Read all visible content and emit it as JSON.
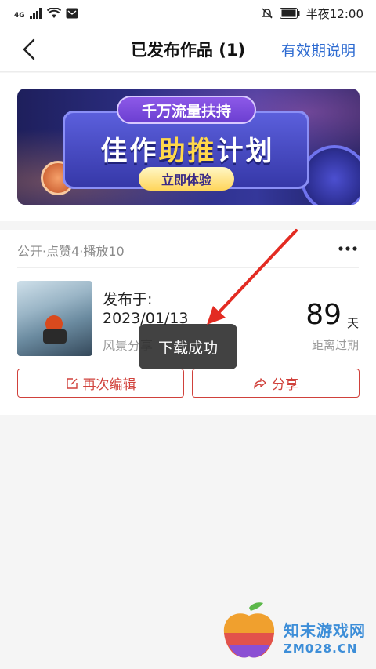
{
  "status_bar": {
    "network": "4G",
    "time": "半夜12:00"
  },
  "nav": {
    "title": "已发布作品 (1)",
    "link": "有效期说明"
  },
  "banner": {
    "top_label": "千万流量扶持",
    "title_part1": "佳作",
    "title_highlight": "助推",
    "title_part2": "计划",
    "button": "立即体验"
  },
  "work": {
    "stats": "公开·点赞4·播放10",
    "published_label": "发布于:",
    "published_date": "2023/01/13",
    "category": "风景分享",
    "days": "89",
    "days_unit": "天",
    "days_caption": "距离过期",
    "edit_label": "再次编辑",
    "share_label": "分享"
  },
  "toast": {
    "message": "下载成功"
  },
  "watermark": {
    "name": "知末游戏网",
    "url": "ZM028.CN"
  },
  "colors": {
    "accent": "#d0413b",
    "link": "#2c6ad1",
    "annotation_arrow": "#e32b22"
  }
}
